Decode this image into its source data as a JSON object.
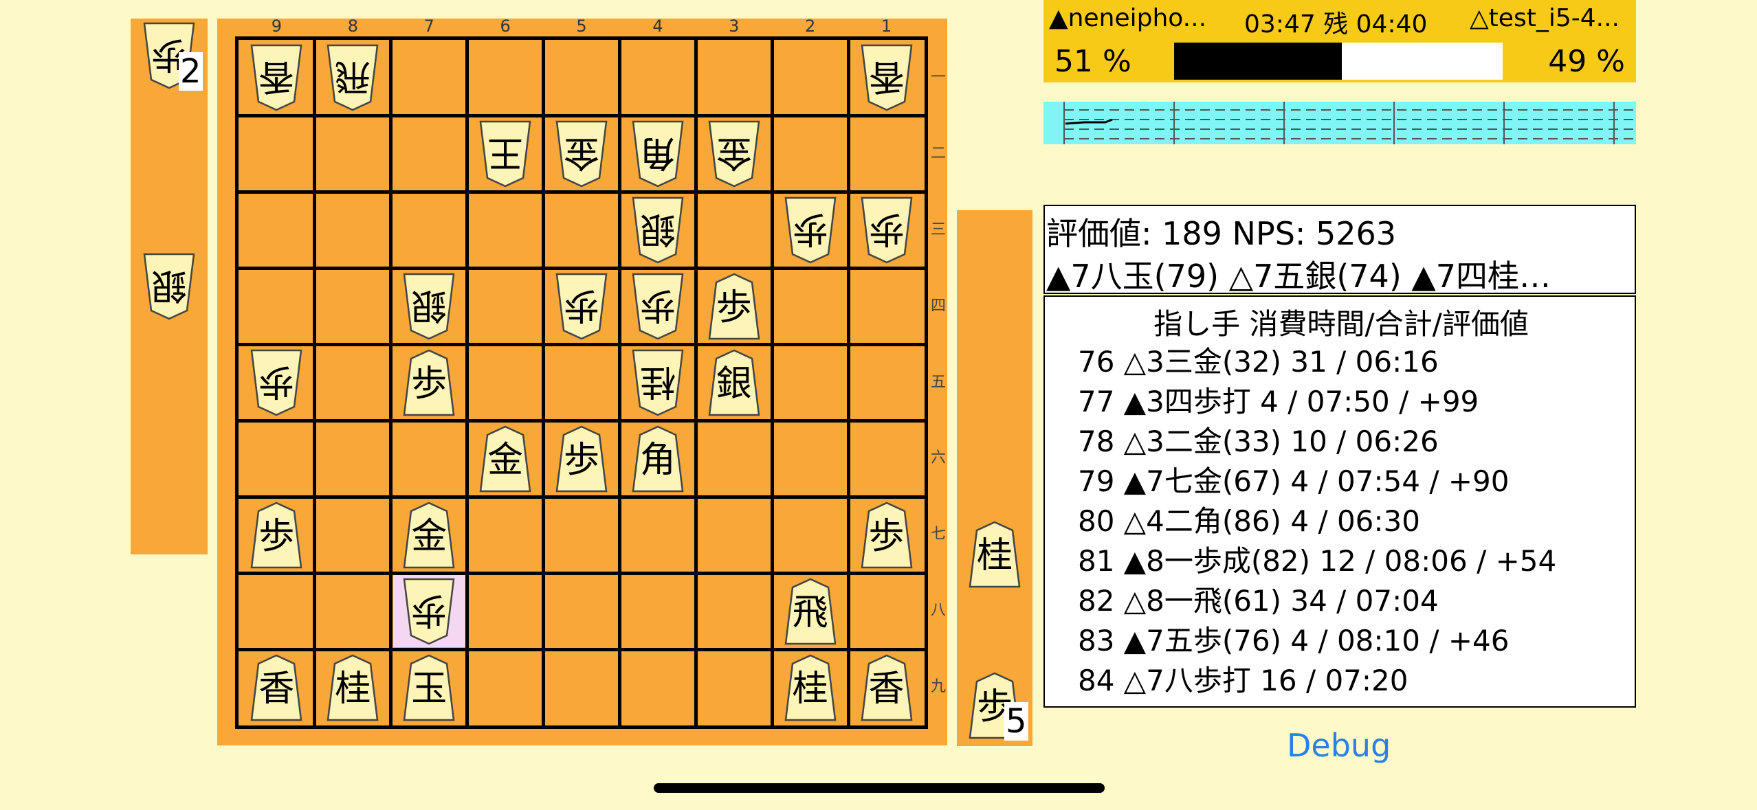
{
  "board": {
    "file_labels": [
      "9",
      "8",
      "7",
      "6",
      "5",
      "4",
      "3",
      "2",
      "1"
    ],
    "rank_labels": [
      "一",
      "二",
      "三",
      "四",
      "五",
      "六",
      "七",
      "八",
      "九"
    ],
    "last_move_square": {
      "file": 7,
      "rank": 8
    },
    "pieces": [
      {
        "file": 9,
        "rank": 1,
        "glyph": "香",
        "side": "gote"
      },
      {
        "file": 8,
        "rank": 1,
        "glyph": "飛",
        "side": "gote"
      },
      {
        "file": 1,
        "rank": 1,
        "glyph": "香",
        "side": "gote"
      },
      {
        "file": 6,
        "rank": 2,
        "glyph": "王",
        "side": "gote"
      },
      {
        "file": 5,
        "rank": 2,
        "glyph": "金",
        "side": "gote"
      },
      {
        "file": 4,
        "rank": 2,
        "glyph": "角",
        "side": "gote"
      },
      {
        "file": 3,
        "rank": 2,
        "glyph": "金",
        "side": "gote"
      },
      {
        "file": 4,
        "rank": 3,
        "glyph": "銀",
        "side": "gote"
      },
      {
        "file": 2,
        "rank": 3,
        "glyph": "歩",
        "side": "gote"
      },
      {
        "file": 1,
        "rank": 3,
        "glyph": "歩",
        "side": "gote"
      },
      {
        "file": 7,
        "rank": 4,
        "glyph": "銀",
        "side": "gote"
      },
      {
        "file": 5,
        "rank": 4,
        "glyph": "歩",
        "side": "gote"
      },
      {
        "file": 4,
        "rank": 4,
        "glyph": "歩",
        "side": "gote"
      },
      {
        "file": 3,
        "rank": 4,
        "glyph": "歩",
        "side": "sente"
      },
      {
        "file": 9,
        "rank": 5,
        "glyph": "歩",
        "side": "gote"
      },
      {
        "file": 7,
        "rank": 5,
        "glyph": "歩",
        "side": "sente"
      },
      {
        "file": 4,
        "rank": 5,
        "glyph": "桂",
        "side": "gote"
      },
      {
        "file": 3,
        "rank": 5,
        "glyph": "銀",
        "side": "sente"
      },
      {
        "file": 6,
        "rank": 6,
        "glyph": "金",
        "side": "sente"
      },
      {
        "file": 5,
        "rank": 6,
        "glyph": "歩",
        "side": "sente"
      },
      {
        "file": 4,
        "rank": 6,
        "glyph": "角",
        "side": "sente"
      },
      {
        "file": 9,
        "rank": 7,
        "glyph": "歩",
        "side": "sente"
      },
      {
        "file": 7,
        "rank": 7,
        "glyph": "金",
        "side": "sente"
      },
      {
        "file": 1,
        "rank": 7,
        "glyph": "歩",
        "side": "sente"
      },
      {
        "file": 7,
        "rank": 8,
        "glyph": "歩",
        "side": "gote"
      },
      {
        "file": 2,
        "rank": 8,
        "glyph": "飛",
        "side": "sente"
      },
      {
        "file": 9,
        "rank": 9,
        "glyph": "香",
        "side": "sente"
      },
      {
        "file": 8,
        "rank": 9,
        "glyph": "桂",
        "side": "sente"
      },
      {
        "file": 7,
        "rank": 9,
        "glyph": "玉",
        "side": "sente"
      },
      {
        "file": 2,
        "rank": 9,
        "glyph": "桂",
        "side": "sente"
      },
      {
        "file": 1,
        "rank": 9,
        "glyph": "香",
        "side": "sente"
      }
    ]
  },
  "gote_hand": [
    {
      "glyph": "歩",
      "count": "2"
    },
    {
      "glyph": "銀",
      "count": ""
    }
  ],
  "sente_hand": [
    {
      "glyph": "桂",
      "count": ""
    },
    {
      "glyph": "歩",
      "count": "5"
    }
  ],
  "players": {
    "sente_name": "▲neneipho...",
    "time_text": "03:47 残 04:40",
    "gote_name": "△test_i5-4...",
    "sente_percent_label": "51 %",
    "gote_percent_label": "49 %",
    "sente_percent": 0.51
  },
  "evaluation": {
    "score_line": "評価値: 189  NPS: 5263",
    "pv_line": "▲7八玉(79) △7五銀(74) ▲7四桂…"
  },
  "kifu": {
    "header": "指し手 消費時間/合計/評価値",
    "moves": [
      "76 △3三金(32)  31 / 06:16",
      "77 ▲3四歩打   4 / 07:50 / +99",
      "78 △3二金(33)  10 / 06:26",
      "79 ▲7七金(67)   4 / 07:54 / +90",
      "80 △4二角(86)   4 / 06:30",
      "81 ▲8一歩成(82)  12 / 08:06 / +54",
      "82 △8一飛(61)  34 / 07:04",
      "83 ▲7五歩(76)   4 / 08:10 / +46",
      "84 △7八歩打  16 / 07:20"
    ]
  },
  "debug_label": "Debug",
  "colors": {
    "background": "#fdf9c8",
    "board": "#f7a838",
    "player_bar": "#f7ca18",
    "timeline": "#7ff5f5",
    "last_move": "#f4d8f2",
    "link": "#2a80e8"
  }
}
